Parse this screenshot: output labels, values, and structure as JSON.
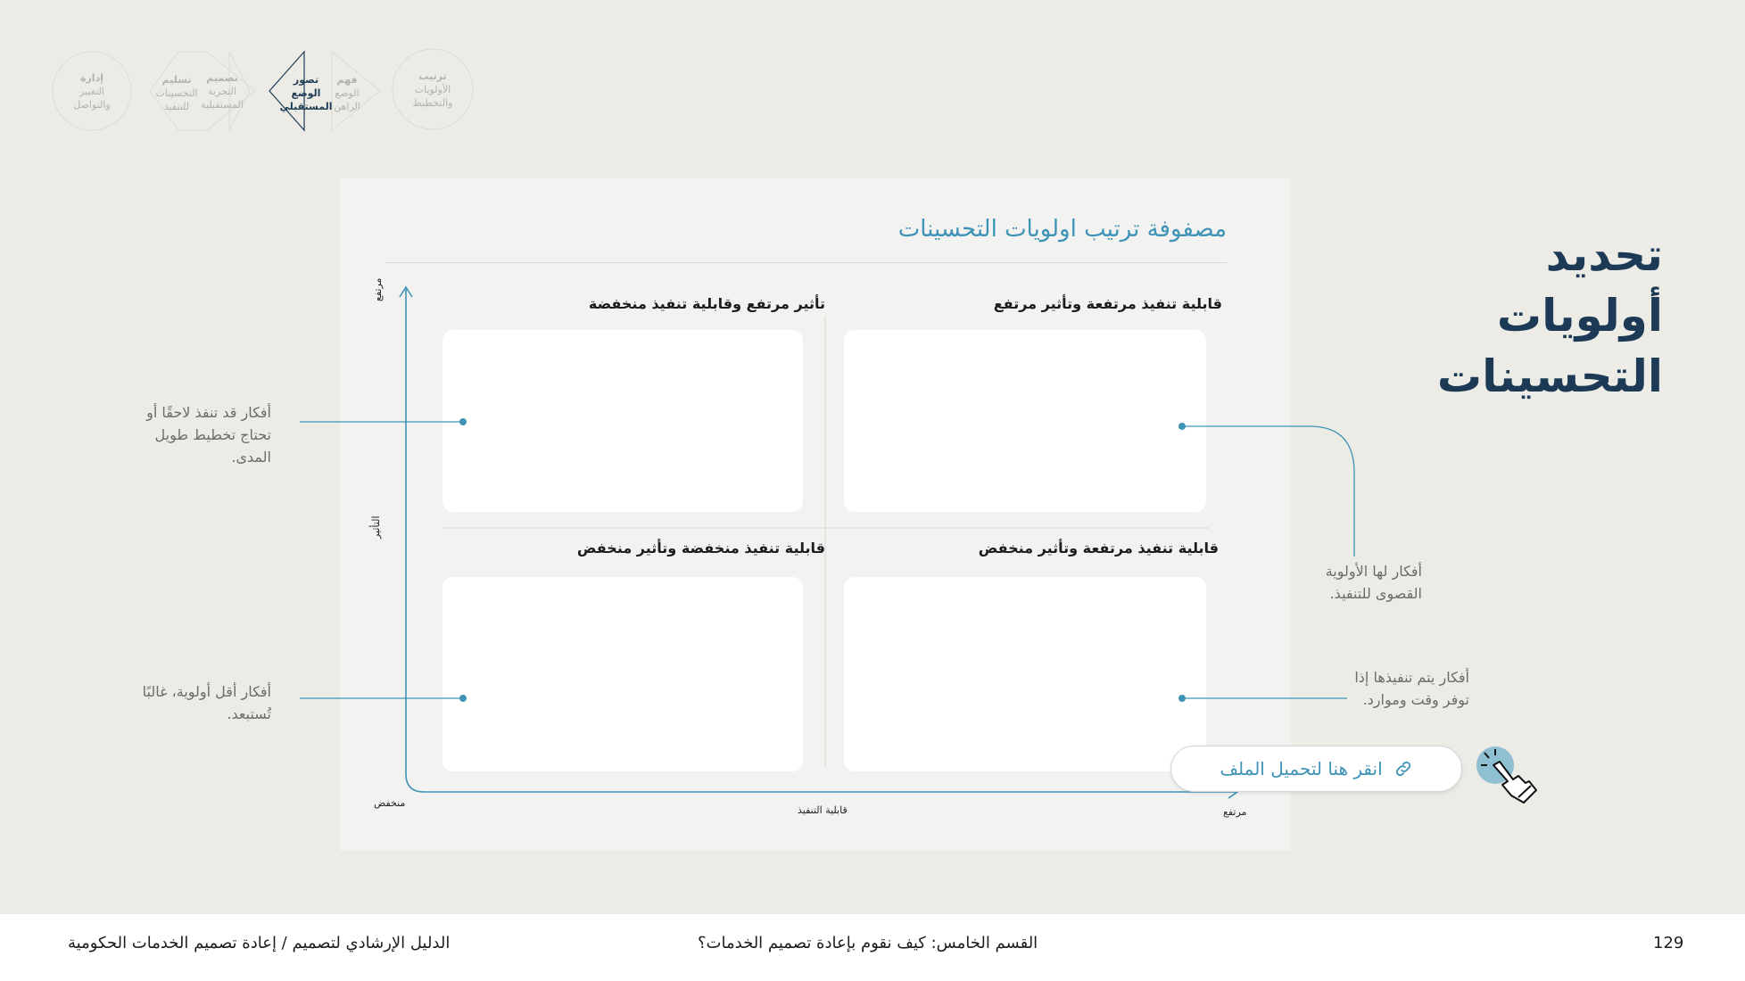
{
  "nav": {
    "items": [
      {
        "title": "ترتيب",
        "sub1": "الأولويات",
        "sub2": "والتخطيط"
      },
      {
        "title": "فهم",
        "sub1": "الوضع",
        "sub2": "الراهن"
      },
      {
        "title": "تصور",
        "sub1": "الوضع",
        "sub2": "المستقبلي"
      },
      {
        "title": "تصميم",
        "sub1": "التجربة",
        "sub2": "المستقبلية"
      },
      {
        "title": "تسليم",
        "sub1": "التحسينات",
        "sub2": "للتنفيذ"
      },
      {
        "title": "إدارة",
        "sub1": "التغيير",
        "sub2": "والتواصل"
      }
    ],
    "active_index": 2
  },
  "page_title_lines": [
    "تحديد",
    "أولويات",
    "التحسينات"
  ],
  "matrix": {
    "title": "مصفوفة ترتيب اولويات التحسينات",
    "quadrants": {
      "top_right": "قابلية تنفيذ مرتفعة وتأثير مرتفع",
      "top_left": "تأثير مرتفع وقابلية تنفيذ منخفضة",
      "bottom_right": "قابلية تنفيذ مرتفعة وتأثير منخفض",
      "bottom_left": "قابلية تنفيذ منخفضة وتأثير منخفض"
    },
    "y_axis": {
      "label": "التأثير",
      "high": "مرتفع"
    },
    "x_axis": {
      "label": "قابلية التنفيذ",
      "low": "منخفض",
      "high": "مرتفع"
    }
  },
  "notes": {
    "left_top": "أفكار قد تنفذ لاحقًا أو تحتاج تخطيط طويل المدى.",
    "left_bottom": "أفكار أقل أولوية، غالبًا تُستبعد.",
    "right_top": "أفكار لها الأولوية القصوى للتنفيذ.",
    "right_bottom": "أفكار يتم تنفيذها إذا توفر وقت وموارد."
  },
  "download": {
    "label": "انقر هنا لتحميل الملف",
    "icon": "link-icon"
  },
  "footer": {
    "page_number": "129",
    "section": "القسم الخامس: كيف نقوم بإعادة تصميم الخدمات؟",
    "guide": "الدليل الإرشادي لتصميم / إعادة تصميم الخدمات الحكومية"
  },
  "colors": {
    "accent": "#3f93b7",
    "title": "#1c3a55",
    "background": "#ecebe5"
  }
}
